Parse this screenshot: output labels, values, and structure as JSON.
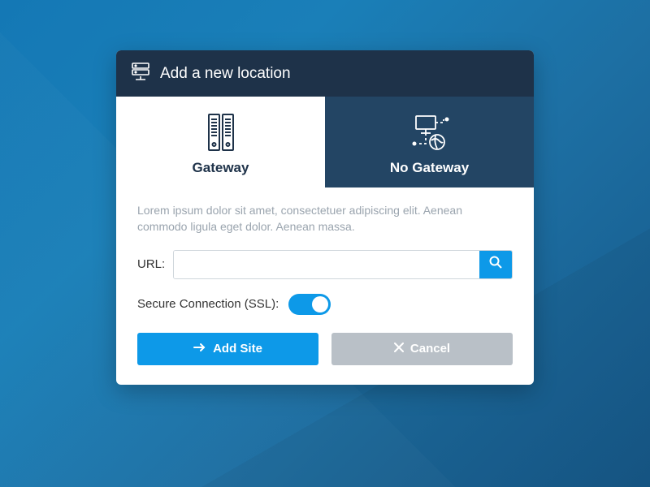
{
  "header": {
    "title": "Add a new location"
  },
  "tabs": {
    "gateway": {
      "label": "Gateway"
    },
    "no_gateway": {
      "label": "No Gateway"
    }
  },
  "description": "Lorem ipsum dolor sit amet, consectetuer adipiscing elit. Aenean commodo ligula eget dolor. Aenean massa.",
  "url": {
    "label": "URL:",
    "value": "",
    "placeholder": ""
  },
  "ssl": {
    "label": "Secure Connection (SSL):",
    "enabled": true
  },
  "buttons": {
    "add": "Add Site",
    "cancel": "Cancel"
  },
  "colors": {
    "accent": "#0d99e8",
    "header": "#1e3249",
    "inactive_tab": "#234564"
  }
}
